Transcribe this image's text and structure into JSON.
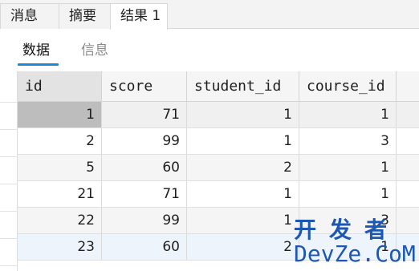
{
  "tabs": [
    {
      "label": "消息"
    },
    {
      "label": "摘要"
    },
    {
      "label": "结果 1"
    }
  ],
  "subtabs": [
    {
      "label": "数据"
    },
    {
      "label": "信息"
    }
  ],
  "table": {
    "columns": [
      "id",
      "score",
      "student_id",
      "course_id"
    ],
    "rows": [
      [
        "1",
        "71",
        "1",
        "1"
      ],
      [
        "2",
        "99",
        "1",
        "3"
      ],
      [
        "5",
        "60",
        "2",
        "1"
      ],
      [
        "21",
        "71",
        "1",
        "1"
      ],
      [
        "22",
        "99",
        "1",
        "3"
      ],
      [
        "23",
        "60",
        "2",
        "1"
      ]
    ]
  },
  "watermark": {
    "line1": "开发者",
    "line2": "DevZe.CoM"
  },
  "colors": {
    "accent": "#1a8ad4",
    "watermark": "#1c58b3"
  }
}
